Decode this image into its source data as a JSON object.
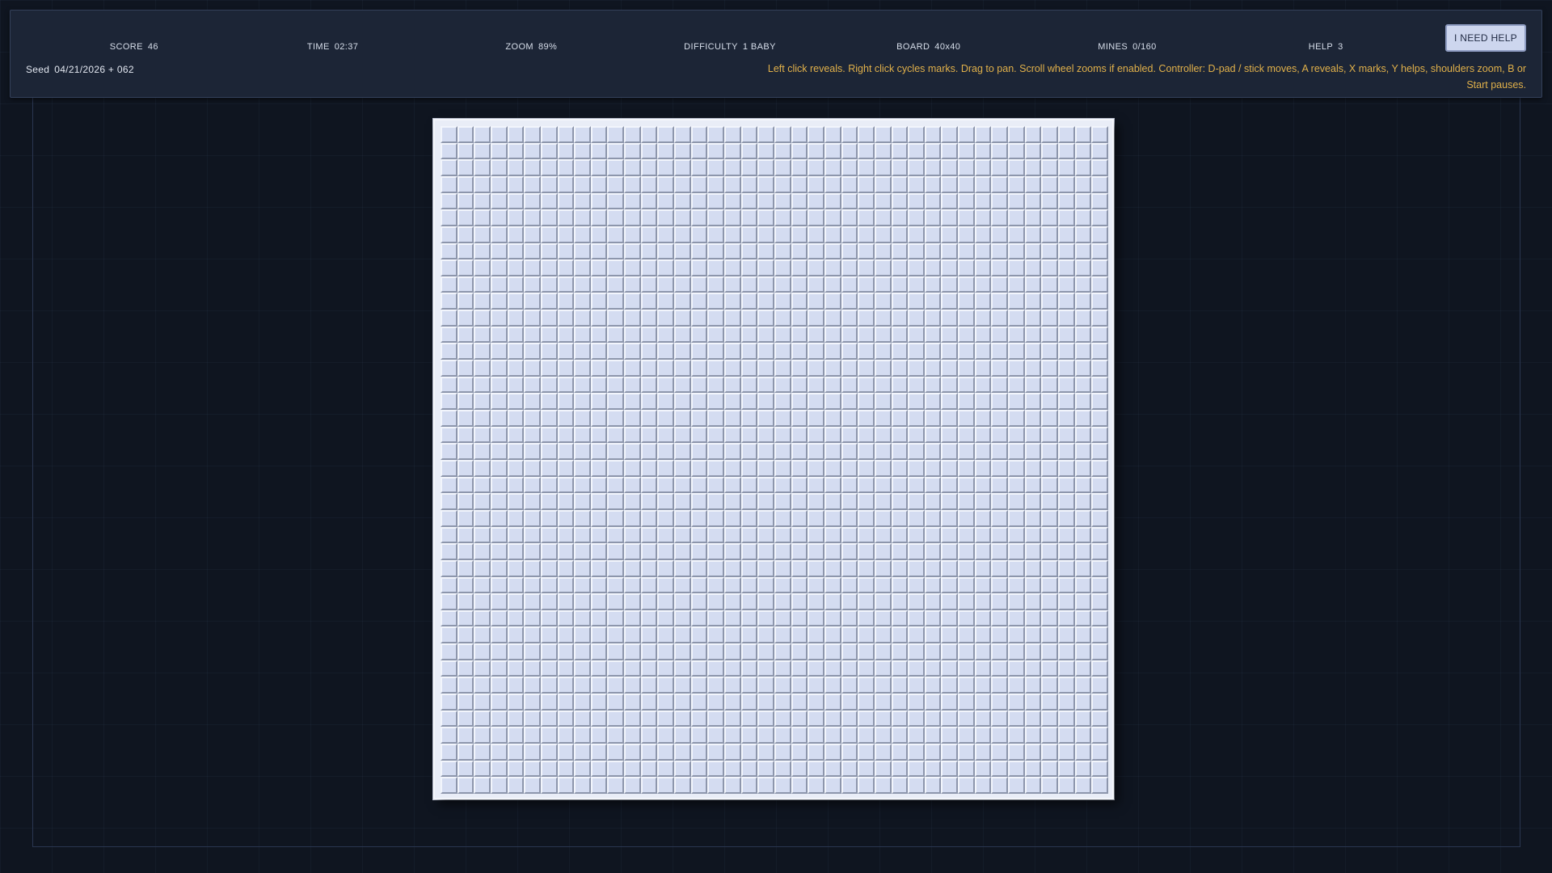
{
  "hud": {
    "stats": [
      {
        "key": "SCORE",
        "value": "46",
        "name": "score-stat"
      },
      {
        "key": "TIME",
        "value": "02:37",
        "name": "time-stat"
      },
      {
        "key": "ZOOM",
        "value": "89%",
        "name": "zoom-stat"
      },
      {
        "key": "DIFFICULTY",
        "value": "1 BABY",
        "name": "difficulty-stat"
      },
      {
        "key": "BOARD",
        "value": "40x40",
        "name": "board-stat"
      },
      {
        "key": "MINES",
        "value": "0/160",
        "name": "mines-stat"
      },
      {
        "key": "HELP",
        "value": "3",
        "name": "help-stat"
      }
    ],
    "help_button_label": "I NEED HELP",
    "seed_label": "Seed",
    "seed_value": "04/21/2026 + 062",
    "hint": "Left click reveals. Right click cycles marks. Drag to pan. Scroll wheel zooms if enabled. Controller: D-pad / stick moves, A reveals, X marks, Y helps, shoulders zoom, B or Start pauses."
  },
  "board": {
    "columns": 40,
    "rows": 40,
    "cell_state": "covered",
    "colors": {
      "cell_face": "#d4dcf1",
      "cell_highlight": "#f2f5fc",
      "cell_shadow": "#8d96ac",
      "hint_text": "#e0b04a",
      "background": "#0f1520"
    }
  }
}
